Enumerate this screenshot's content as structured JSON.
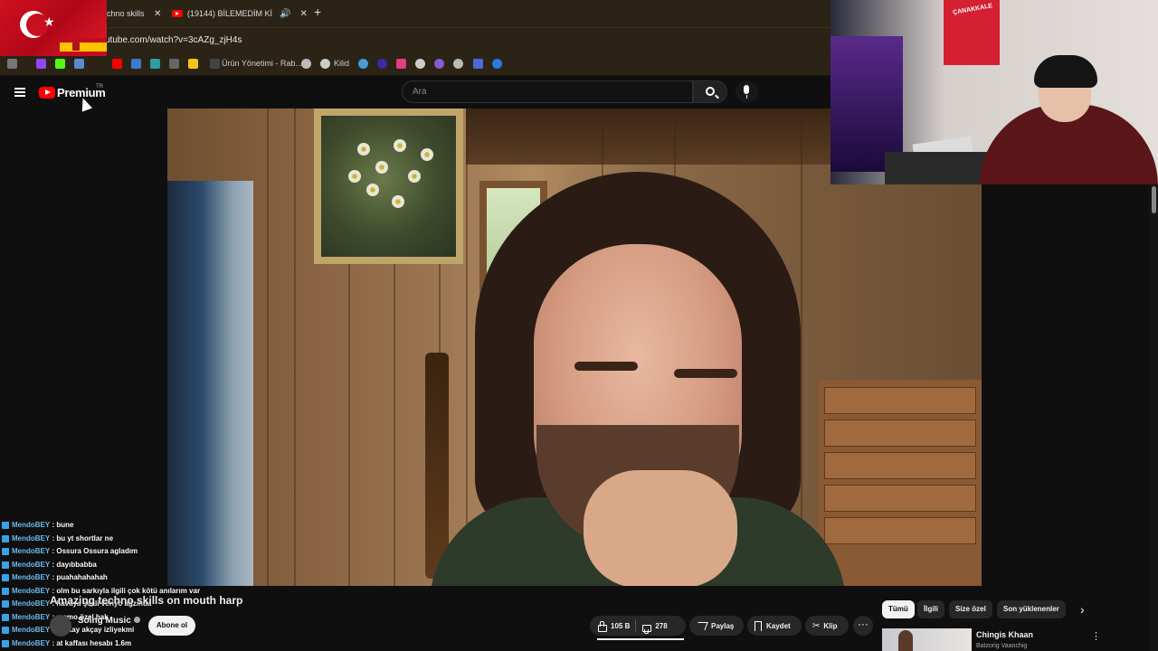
{
  "browser": {
    "tabs": [
      {
        "label": "chno skills o"
      },
      {
        "label": "(19144) BİLEMEDİM Kİ - Yo"
      }
    ],
    "url": "utube.com/watch?v=3cAZg_zjH4s",
    "bookmarks": [
      {
        "label": "Ürün Yönetimi - Rab..."
      },
      {
        "label": "Kilid"
      }
    ]
  },
  "youtube": {
    "logo_text": "Premium",
    "logo_region": "TR",
    "search_placeholder": "Ara"
  },
  "webcam": {
    "poster_text": "ÇANAKKALE"
  },
  "chat": [
    {
      "user": "MendoBEY",
      "msg": "bune"
    },
    {
      "user": "MendoBEY",
      "msg": "bu yt shortlar ne"
    },
    {
      "user": "MendoBEY",
      "msg": "Ossura Ossura agladım"
    },
    {
      "user": "MendoBEY",
      "msg": "dayıbbabba"
    },
    {
      "user": "MendoBEY",
      "msg": "puahahahahah"
    },
    {
      "user": "MendoBEY",
      "msg": "olm bu sarkıyla ilgili çok kötü anılarım var"
    },
    {
      "user": "MendoBEY",
      "msg": "havaya şeali veriyo ağzında"
    },
    {
      "user": "MendoBEY",
      "msg": "memo özel hak"
    },
    {
      "user": "MendoBEY",
      "msg": "berkay akçay izliyekmi"
    },
    {
      "user": "MendoBEY",
      "msg": "at kaffası hesabı 1.6m"
    }
  ],
  "video": {
    "title": "Amazing techno skills on mouth harp",
    "channel": "Soing Music",
    "subscribe_label": "Abone ol",
    "likes": "105 B",
    "dislikes": "278",
    "share_label": "Paylaş",
    "save_label": "Kaydet",
    "clip_label": "Klip",
    "more_label": "···"
  },
  "chips": [
    "Tümü",
    "İlgili",
    "Size özel",
    "Son yüklenenler"
  ],
  "recommendation": {
    "title": "Chingis Khaan",
    "channel": "Batzorig Vaanchig"
  }
}
